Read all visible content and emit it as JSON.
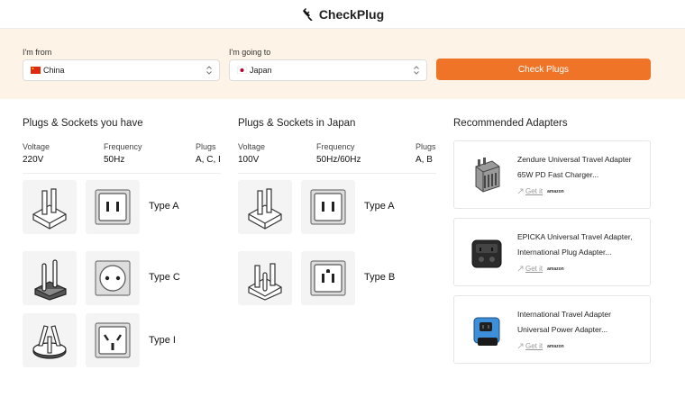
{
  "header": {
    "brand": "CheckPlug",
    "logo_icon": "plug-icon"
  },
  "search": {
    "from_label": "I'm from",
    "from_value": "China",
    "to_label": "I'm going to",
    "to_value": "Japan",
    "button_label": "Check Plugs",
    "accent": "#f07427"
  },
  "have": {
    "title": "Plugs & Sockets you have",
    "voltage_label": "Voltage",
    "voltage": "220V",
    "frequency_label": "Frequency",
    "frequency": "50Hz",
    "plugs_label": "Plugs",
    "plugs": "A, C, I",
    "types": [
      {
        "label": "Type A"
      },
      {
        "label": "Type C"
      },
      {
        "label": "Type I"
      }
    ]
  },
  "destination": {
    "title": "Plugs & Sockets in Japan",
    "voltage_label": "Voltage",
    "voltage": "100V",
    "frequency_label": "Frequency",
    "frequency": "50Hz/60Hz",
    "plugs_label": "Plugs",
    "plugs": "A, B",
    "types": [
      {
        "label": "Type A"
      },
      {
        "label": "Type B"
      }
    ]
  },
  "adapters": {
    "title": "Recommended Adapters",
    "get_it_label": "Get it",
    "store": "amazon",
    "items": [
      {
        "line1": "Zendure Universal Travel Adapter",
        "line2": "65W PD Fast Charger..."
      },
      {
        "line1": "EPICKA Universal Travel Adapter,",
        "line2": "International Plug Adapter..."
      },
      {
        "line1": "International Travel Adapter",
        "line2": "Universal Power Adapter..."
      }
    ]
  }
}
